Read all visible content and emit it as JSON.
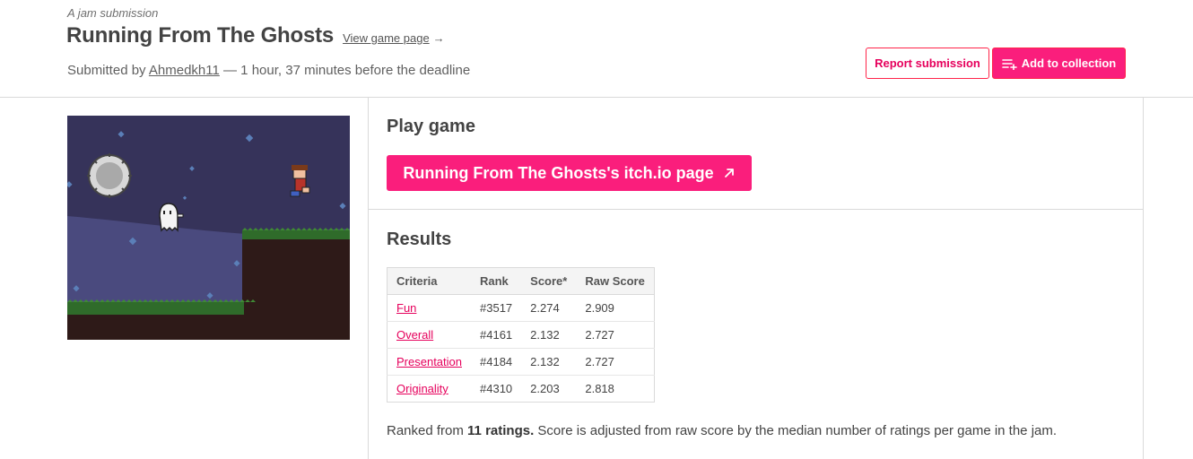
{
  "header": {
    "jam_label": "A jam submission",
    "title": "Running From The Ghosts",
    "view_page": "View game page",
    "view_page_arrow": "→",
    "submitted_prefix": "Submitted by",
    "author": "Ahmedkh11",
    "submitted_suffix": "— 1 hour, 37 minutes before the deadline",
    "report_button": "Report submission",
    "collection_button": "Add to collection"
  },
  "screenshot": {
    "icon": "game-screenshot"
  },
  "play": {
    "title": "Play game",
    "button": "Running From The Ghosts's itch.io page",
    "button_icon": "external-link-icon"
  },
  "results": {
    "title": "Results",
    "columns": [
      "Criteria",
      "Rank",
      "Score*",
      "Raw Score"
    ],
    "rows": [
      {
        "criteria": "Fun",
        "rank": "#3517",
        "score": "2.274",
        "raw": "2.909"
      },
      {
        "criteria": "Overall",
        "rank": "#4161",
        "score": "2.132",
        "raw": "2.727"
      },
      {
        "criteria": "Presentation",
        "rank": "#4184",
        "score": "2.132",
        "raw": "2.727"
      },
      {
        "criteria": "Originality",
        "rank": "#4310",
        "score": "2.203",
        "raw": "2.818"
      }
    ],
    "ranked_prefix": "Ranked from",
    "ranked_count": "11 ratings.",
    "ranked_suffix": "Score is adjusted from raw score by the median number of ratings per game in the jam."
  },
  "colors": {
    "accent": "#fa1e7c",
    "link": "#e6005c",
    "border": "#dadada"
  }
}
